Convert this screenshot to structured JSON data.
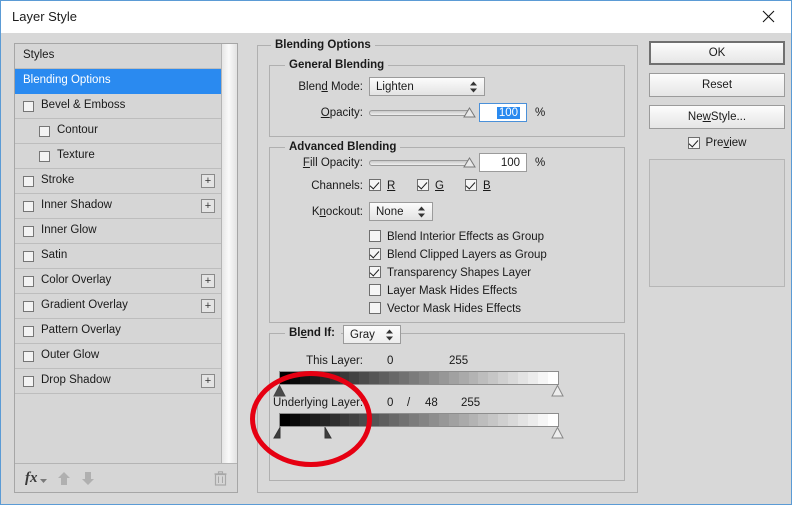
{
  "window": {
    "title": "Layer Style",
    "close_icon": "close-icon",
    "accent": "#2a8af0",
    "annotation_color": "#e60012"
  },
  "sidebar": {
    "items": [
      {
        "label": "Styles",
        "checkbox": false,
        "checked": false,
        "indent": false,
        "plus": false,
        "selected": false
      },
      {
        "label": "Blending Options",
        "checkbox": false,
        "checked": false,
        "indent": false,
        "plus": false,
        "selected": true
      },
      {
        "label": "Bevel & Emboss",
        "checkbox": true,
        "checked": false,
        "indent": false,
        "plus": false,
        "selected": false
      },
      {
        "label": "Contour",
        "checkbox": true,
        "checked": false,
        "indent": true,
        "plus": false,
        "selected": false
      },
      {
        "label": "Texture",
        "checkbox": true,
        "checked": false,
        "indent": true,
        "plus": false,
        "selected": false
      },
      {
        "label": "Stroke",
        "checkbox": true,
        "checked": false,
        "indent": false,
        "plus": true,
        "selected": false
      },
      {
        "label": "Inner Shadow",
        "checkbox": true,
        "checked": false,
        "indent": false,
        "plus": true,
        "selected": false
      },
      {
        "label": "Inner Glow",
        "checkbox": true,
        "checked": false,
        "indent": false,
        "plus": false,
        "selected": false
      },
      {
        "label": "Satin",
        "checkbox": true,
        "checked": false,
        "indent": false,
        "plus": false,
        "selected": false
      },
      {
        "label": "Color Overlay",
        "checkbox": true,
        "checked": false,
        "indent": false,
        "plus": true,
        "selected": false
      },
      {
        "label": "Gradient Overlay",
        "checkbox": true,
        "checked": false,
        "indent": false,
        "plus": true,
        "selected": false
      },
      {
        "label": "Pattern Overlay",
        "checkbox": true,
        "checked": false,
        "indent": false,
        "plus": false,
        "selected": false
      },
      {
        "label": "Outer Glow",
        "checkbox": true,
        "checked": false,
        "indent": false,
        "plus": false,
        "selected": false
      },
      {
        "label": "Drop Shadow",
        "checkbox": true,
        "checked": false,
        "indent": false,
        "plus": true,
        "selected": false
      }
    ],
    "plus_label": "+",
    "toolbar": {
      "fx_label": "fx",
      "fx_icon": "fx-icon",
      "move_up_icon": "arrow-up-icon",
      "move_down_icon": "arrow-down-icon",
      "delete_icon": "trash-icon"
    }
  },
  "main": {
    "blending_options_title": "Blending Options",
    "general_blending": {
      "title": "General Blending",
      "blend_mode_label": "Blend Mode:",
      "blend_mode_value": "Lighten",
      "opacity_label": "Opacity:",
      "opacity_value": "100",
      "opacity_unit": "%"
    },
    "advanced_blending": {
      "title": "Advanced Blending",
      "fill_opacity_label": "Fill Opacity:",
      "fill_opacity_value": "100",
      "fill_opacity_unit": "%",
      "channels_label": "Channels:",
      "channels": [
        {
          "label": "R",
          "checked": true
        },
        {
          "label": "G",
          "checked": true
        },
        {
          "label": "B",
          "checked": true
        }
      ],
      "knockout_label": "Knockout:",
      "knockout_value": "None",
      "options": [
        {
          "label": "Blend Interior Effects as Group",
          "checked": false
        },
        {
          "label": "Blend Clipped Layers as Group",
          "checked": true
        },
        {
          "label": "Transparency Shapes Layer",
          "checked": true
        },
        {
          "label": "Layer Mask Hides Effects",
          "checked": false
        },
        {
          "label": "Vector Mask Hides Effects",
          "checked": false
        }
      ]
    },
    "blend_if": {
      "label": "Blend If:",
      "channel_value": "Gray",
      "this_layer": {
        "label": "This Layer:",
        "low": "0",
        "high": "255"
      },
      "underlying_layer": {
        "label": "Underlying Layer:",
        "low": "0",
        "separator": "/",
        "low_split": "48",
        "high": "255"
      }
    }
  },
  "buttons": {
    "ok": "OK",
    "reset": "Reset",
    "new_style": "New Style...",
    "preview_label": "Preview",
    "preview_checked": true
  }
}
